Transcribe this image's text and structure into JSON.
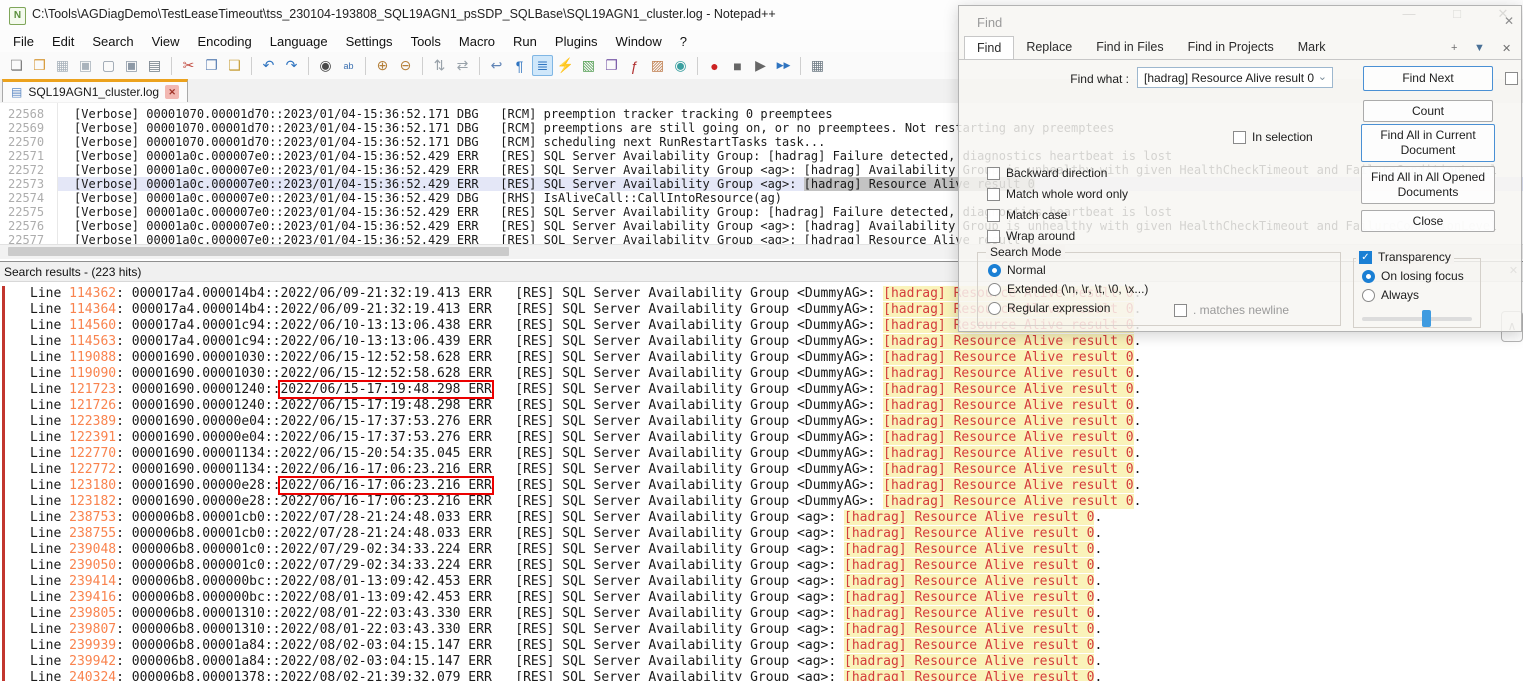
{
  "window": {
    "title": "C:\\Tools\\AGDiagDemo\\TestLeaseTimeout\\tss_230104-193808_SQL19AGN1_psSDP_SQLBase\\SQL19AGN1_cluster.log - Notepad++",
    "controls": {
      "minimize": "—",
      "maximize": "□",
      "close": "✕"
    }
  },
  "menu": {
    "items": [
      "File",
      "Edit",
      "Search",
      "View",
      "Encoding",
      "Language",
      "Settings",
      "Tools",
      "Macro",
      "Run",
      "Plugins",
      "Window",
      "?"
    ]
  },
  "toolbar": {
    "icons": [
      {
        "name": "new-file",
        "glyph": "❏",
        "color": "#7d7d7d"
      },
      {
        "name": "open-file",
        "glyph": "❒",
        "color": "#d79b3c"
      },
      {
        "name": "save",
        "glyph": "▦",
        "color": "#a9b3bc"
      },
      {
        "name": "save-all",
        "glyph": "▣",
        "color": "#a9b3bc"
      },
      {
        "name": "close-document",
        "glyph": "▢",
        "color": "#8d99a6"
      },
      {
        "name": "close-all-documents",
        "glyph": "▣",
        "color": "#8d99a6"
      },
      {
        "name": "print",
        "glyph": "▤",
        "color": "#6f7b85"
      },
      {
        "name": "separator"
      },
      {
        "name": "cut",
        "glyph": "✂",
        "color": "#c34f44"
      },
      {
        "name": "copy",
        "glyph": "❐",
        "color": "#5f83b5"
      },
      {
        "name": "paste",
        "glyph": "❑",
        "color": "#c9a23f"
      },
      {
        "name": "separator"
      },
      {
        "name": "undo",
        "glyph": "↶",
        "color": "#2f74c0"
      },
      {
        "name": "redo",
        "glyph": "↷",
        "color": "#2f74c0"
      },
      {
        "name": "separator"
      },
      {
        "name": "find",
        "glyph": "◉",
        "color": "#4a4a4a"
      },
      {
        "name": "replace",
        "glyph": "ab",
        "color": "#3a6fb0"
      },
      {
        "name": "separator"
      },
      {
        "name": "zoom-in",
        "glyph": "⊕",
        "color": "#b5803a"
      },
      {
        "name": "zoom-out",
        "glyph": "⊖",
        "color": "#b5803a"
      },
      {
        "name": "separator"
      },
      {
        "name": "sync-vertical-scrolling",
        "glyph": "⇅",
        "color": "#99a2aa"
      },
      {
        "name": "sync-horizontal-scrolling",
        "glyph": "⇄",
        "color": "#99a2aa"
      },
      {
        "name": "separator"
      },
      {
        "name": "word-wrap",
        "glyph": "↩",
        "color": "#5f83b5"
      },
      {
        "name": "show-all-characters",
        "glyph": "¶",
        "color": "#2f74c0"
      },
      {
        "name": "indent-guide",
        "glyph": "≣",
        "color": "#2f74c0",
        "active": true
      },
      {
        "name": "user-defined-language",
        "glyph": "⚡",
        "color": "#d9a52a"
      },
      {
        "name": "document-map",
        "glyph": "▧",
        "color": "#58a058"
      },
      {
        "name": "document-switcher",
        "glyph": "❐",
        "color": "#7a5ba8"
      },
      {
        "name": "function-list",
        "glyph": "ƒ",
        "color": "#b03030"
      },
      {
        "name": "folder-as-workspace",
        "glyph": "▨",
        "color": "#c07f4f"
      },
      {
        "name": "document-monitoring",
        "glyph": "◉",
        "color": "#3aa0a0"
      },
      {
        "name": "separator"
      },
      {
        "name": "macro-record",
        "glyph": "●",
        "color": "#cc2222"
      },
      {
        "name": "macro-stop",
        "glyph": "■",
        "color": "#666666"
      },
      {
        "name": "macro-play",
        "glyph": "▶",
        "color": "#666666"
      },
      {
        "name": "macro-run-multiple",
        "glyph": "▶▶",
        "color": "#2f74c0"
      },
      {
        "name": "separator"
      },
      {
        "name": "macro-save",
        "glyph": "▦",
        "color": "#6f7b85"
      }
    ]
  },
  "tab": {
    "label": "SQL19AGN1_cluster.log",
    "close_glyph": "✕",
    "accent_color": "#eca21d"
  },
  "editor": {
    "lines": [
      {
        "num": "22568",
        "segs": [
          {
            "t": "[Verbose] 00001070.00001d70::2023/01/04-15:36:52.171 DBG   [RCM] preemption tracker tracking 0 preemptees"
          }
        ]
      },
      {
        "num": "22569",
        "segs": [
          {
            "t": "[Verbose] 00001070.00001d70::2023/01/04-15:36:52.171 DBG   [RCM] preemptions are still going on, or no preemptees. Not restarting any preemptees"
          }
        ]
      },
      {
        "num": "22570",
        "segs": [
          {
            "t": "[Verbose] 00001070.00001d70::2023/01/04-15:36:52.171 DBG   [RCM] scheduling next RunRestartTasks task..."
          }
        ]
      },
      {
        "num": "22571",
        "segs": [
          {
            "t": "[Verbose] 00001a0c.000007e0::2023/01/04-15:36:52.429 ERR   [RES] SQL Server Availability Group: [hadrag] Failure detected, diagnostics heartbeat is lost"
          }
        ]
      },
      {
        "num": "22572",
        "segs": [
          {
            "t": "[Verbose] 00001a0c.000007e0::2023/01/04-15:36:52.429 ERR   [RES] SQL Server Availability Group <ag>: [hadrag] Availability Group is unhealthy with given HealthCheckTimeout and FailureConditionLevel"
          }
        ]
      },
      {
        "num": "22573",
        "current": true,
        "segs": [
          {
            "t": "[Verbose] 00001a0c.000007e0::2023/01/04-15:36:52.429 ERR   [RES] SQL Server Availability Group <ag>: "
          },
          {
            "t": "[hadrag] Resource Alive result 0",
            "sel": true
          }
        ]
      },
      {
        "num": "22574",
        "segs": [
          {
            "t": "[Verbose] 00001a0c.000007e0::2023/01/04-15:36:52.429 DBG   [RHS] IsAliveCall::CallIntoResource(ag)"
          }
        ]
      },
      {
        "num": "22575",
        "segs": [
          {
            "t": "[Verbose] 00001a0c.000007e0::2023/01/04-15:36:52.429 ERR   [RES] SQL Server Availability Group: [hadrag] Failure detected, diagnostics heartbeat is lost"
          }
        ]
      },
      {
        "num": "22576",
        "segs": [
          {
            "t": "[Verbose] 00001a0c.000007e0::2023/01/04-15:36:52.429 ERR   [RES] SQL Server Availability Group <ag>: [hadrag] Availability Group is unhealthy with given HealthCheckTimeout and FailureConditionLevel"
          }
        ]
      },
      {
        "num": "22577",
        "segs": [
          {
            "t": "[Verbose] 00001a0c.000007e0::2023/01/04-15:36:52.429 ERR   [RES] SQL Server Availability Group <ag>: [hadrag] Resource Alive result 0"
          }
        ]
      }
    ]
  },
  "results": {
    "header": "Search results - (223 hits)",
    "row_template": {
      "line_prefix": "Line ",
      "sep": ": ",
      "gap": "   ",
      "res_prefix": "[RES] SQL Server Availability Group <",
      "res_suffix": ">: ",
      "match": "[hadrag] Resource Alive result 0",
      "tail": "."
    },
    "rows": [
      {
        "line": "114362",
        "body": "000017a4.000014b4::2022/06/09-21:32:19.413 ERR",
        "group": "DummyAG"
      },
      {
        "line": "114364",
        "body": "000017a4.000014b4::2022/06/09-21:32:19.413 ERR",
        "group": "DummyAG"
      },
      {
        "line": "114560",
        "body": "000017a4.00001c94::2022/06/10-13:13:06.438 ERR",
        "group": "DummyAG"
      },
      {
        "line": "114563",
        "body": "000017a4.00001c94::2022/06/10-13:13:06.439 ERR",
        "group": "DummyAG"
      },
      {
        "line": "119088",
        "body": "00001690.00001030::2022/06/15-12:52:58.628 ERR",
        "group": "DummyAG"
      },
      {
        "line": "119090",
        "body": "00001690.00001030::2022/06/15-12:52:58.628 ERR",
        "group": "DummyAG"
      },
      {
        "line": "121723",
        "pre": "00001690.00001240::",
        "boxed": "2022/06/15-17:19:48.298 ERR",
        "group": "DummyAG"
      },
      {
        "line": "121726",
        "body": "00001690.00001240::2022/06/15-17:19:48.298 ERR",
        "group": "DummyAG"
      },
      {
        "line": "122389",
        "body": "00001690.00000e04::2022/06/15-17:37:53.276 ERR",
        "group": "DummyAG"
      },
      {
        "line": "122391",
        "body": "00001690.00000e04::2022/06/15-17:37:53.276 ERR",
        "group": "DummyAG"
      },
      {
        "line": "122770",
        "body": "00001690.00001134::2022/06/15-20:54:35.045 ERR",
        "group": "DummyAG"
      },
      {
        "line": "122772",
        "body": "00001690.00001134::2022/06/16-17:06:23.216 ERR",
        "group": "DummyAG"
      },
      {
        "line": "123180",
        "pre": "00001690.00000e28::",
        "boxed": "2022/06/16-17:06:23.216 ERR",
        "group": "DummyAG"
      },
      {
        "line": "123182",
        "body": "00001690.00000e28::2022/06/16-17:06:23.216 ERR",
        "group": "DummyAG"
      },
      {
        "line": "238753",
        "body": "000006b8.00001cb0::2022/07/28-21:24:48.033 ERR",
        "group": "ag"
      },
      {
        "line": "238755",
        "body": "000006b8.00001cb0::2022/07/28-21:24:48.033 ERR",
        "group": "ag"
      },
      {
        "line": "239048",
        "body": "000006b8.000001c0::2022/07/29-02:34:33.224 ERR",
        "group": "ag"
      },
      {
        "line": "239050",
        "body": "000006b8.000001c0::2022/07/29-02:34:33.224 ERR",
        "group": "ag"
      },
      {
        "line": "239414",
        "body": "000006b8.000000bc::2022/08/01-13:09:42.453 ERR",
        "group": "ag"
      },
      {
        "line": "239416",
        "body": "000006b8.000000bc::2022/08/01-13:09:42.453 ERR",
        "group": "ag"
      },
      {
        "line": "239805",
        "body": "000006b8.00001310::2022/08/01-22:03:43.330 ERR",
        "group": "ag"
      },
      {
        "line": "239807",
        "body": "000006b8.00001310::2022/08/01-22:03:43.330 ERR",
        "group": "ag"
      },
      {
        "line": "239939",
        "body": "000006b8.00001a84::2022/08/02-03:04:15.147 ERR",
        "group": "ag"
      },
      {
        "line": "239942",
        "body": "000006b8.00001a84::2022/08/02-03:04:15.147 ERR",
        "group": "ag"
      },
      {
        "line": "240324",
        "body": "000006b8.00001378::2022/08/02-21:39:32.079 ERR",
        "group": "ag"
      }
    ],
    "colors": {
      "line_number": "#f9834e",
      "match_text": "#d43c3c",
      "match_highlight": "#faf3ba",
      "annotation_box": "#ec0000"
    }
  },
  "find_dialog": {
    "title": "Find",
    "close_glyph": "✕",
    "tabs": [
      "Find",
      "Replace",
      "Find in Files",
      "Find in Projects",
      "Mark"
    ],
    "active_tab": "Find",
    "tabbar_controls": {
      "add": "+",
      "dropdown": "▼",
      "close": "✕"
    },
    "find_what_label": "Find what :",
    "find_what_value": "[hadrag] Resource Alive result 0",
    "buttons": {
      "find_next": "Find Next",
      "count": "Count",
      "find_all_current": "Find All in Current Document",
      "find_all_opened": "Find All in All Opened Documents",
      "close": "Close"
    },
    "options": [
      {
        "label": "Backward direction",
        "checked": false
      },
      {
        "label": "Match whole word only",
        "checked": false
      },
      {
        "label": "Match case",
        "checked": false
      },
      {
        "label": "Wrap around",
        "checked": false
      }
    ],
    "in_selection": {
      "label": "In selection",
      "checked": false
    },
    "search_mode": {
      "label": "Search Mode",
      "options": [
        {
          "label": "Normal",
          "selected": true
        },
        {
          "label": "Extended (\\n, \\r, \\t, \\0, \\x...)",
          "selected": false
        },
        {
          "label": "Regular expression",
          "selected": false
        }
      ],
      "matches_newline": {
        "label": ". matches newline",
        "checked": false,
        "disabled": true
      }
    },
    "transparency": {
      "label": "Transparency",
      "checked": true,
      "options": [
        {
          "label": "On losing focus",
          "selected": true
        },
        {
          "label": "Always",
          "selected": false
        }
      ],
      "slider_percent": 58
    },
    "accent_color": "#1a7fd4"
  }
}
